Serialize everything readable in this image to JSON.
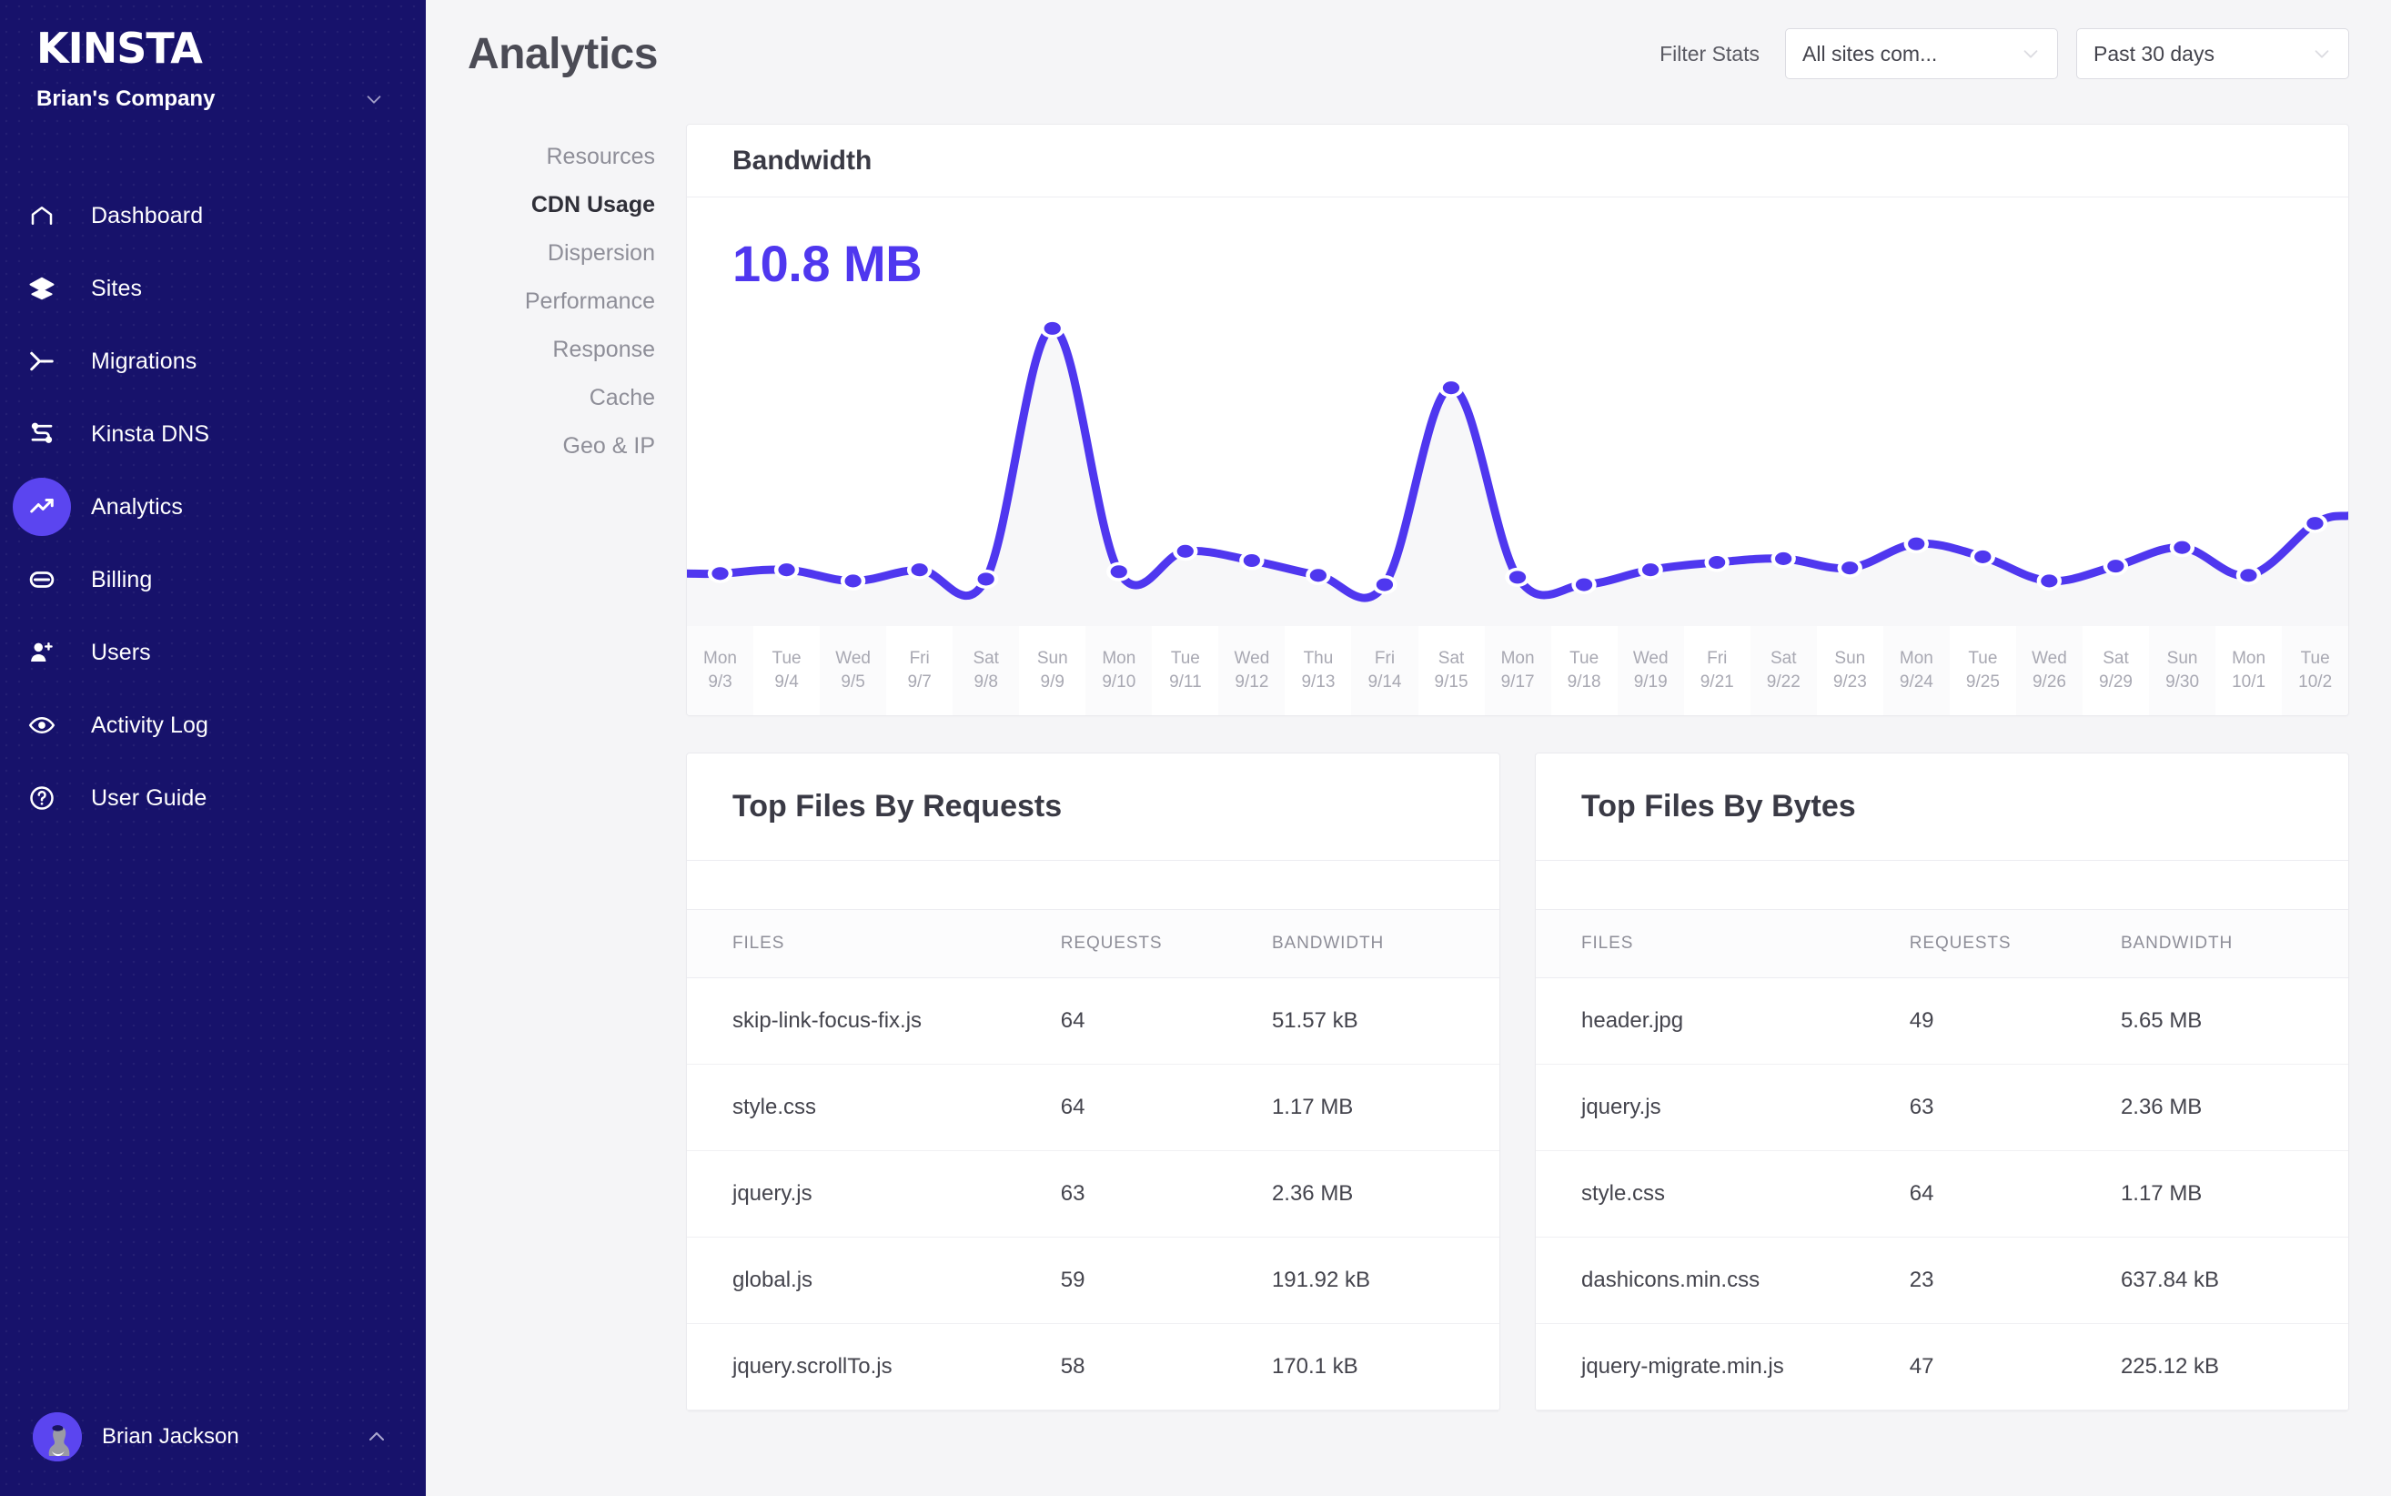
{
  "sidebar": {
    "logo": "KINSTA",
    "company": "Brian's Company",
    "company_chevron_icon": "chevron-down-icon",
    "items": [
      {
        "label": "Dashboard",
        "icon": "home-icon",
        "active": false
      },
      {
        "label": "Sites",
        "icon": "layers-icon",
        "active": false
      },
      {
        "label": "Migrations",
        "icon": "migrations-icon",
        "active": false
      },
      {
        "label": "Kinsta DNS",
        "icon": "dns-icon",
        "active": false
      },
      {
        "label": "Analytics",
        "icon": "trend-up-icon",
        "active": true
      },
      {
        "label": "Billing",
        "icon": "card-icon",
        "active": false
      },
      {
        "label": "Users",
        "icon": "user-plus-icon",
        "active": false
      },
      {
        "label": "Activity Log",
        "icon": "eye-icon",
        "active": false
      },
      {
        "label": "User Guide",
        "icon": "question-circle-icon",
        "active": false
      }
    ],
    "user": {
      "name": "Brian Jackson",
      "caret_icon": "chevron-up-icon"
    }
  },
  "header": {
    "title": "Analytics",
    "filter_label": "Filter Stats",
    "site_select": {
      "value": "All sites com...",
      "chevron_icon": "chevron-down-icon"
    },
    "range_select": {
      "value": "Past 30 days",
      "chevron_icon": "chevron-down-icon"
    }
  },
  "subnav": {
    "items": [
      {
        "label": "Resources",
        "active": false
      },
      {
        "label": "CDN Usage",
        "active": true
      },
      {
        "label": "Dispersion",
        "active": false
      },
      {
        "label": "Performance",
        "active": false
      },
      {
        "label": "Response",
        "active": false
      },
      {
        "label": "Cache",
        "active": false
      },
      {
        "label": "Geo & IP",
        "active": false
      }
    ]
  },
  "bandwidth_card": {
    "title": "Bandwidth",
    "value": "10.8 MB"
  },
  "chart_data": {
    "type": "line",
    "title": "Bandwidth",
    "xlabel": "",
    "ylabel": "Bandwidth",
    "grid": false,
    "legend": "none",
    "series_color": "#4f37ef",
    "fill_color": "#f7f7f9",
    "total_label": "10.8 MB",
    "units": "MB",
    "ylim": [
      0,
      1.6
    ],
    "categories": [
      "Mon 9/3",
      "Tue 9/4",
      "Wed 9/5",
      "Fri 9/7",
      "Sat 9/8",
      "Sun 9/9",
      "Mon 9/10",
      "Tue 9/11",
      "Wed 9/12",
      "Thu 9/13",
      "Fri 9/14",
      "Sat 9/15",
      "Mon 9/17",
      "Tue 9/18",
      "Wed 9/19",
      "Fri 9/21",
      "Sat 9/22",
      "Sun 9/23",
      "Mon 9/24",
      "Tue 9/25",
      "Wed 9/26",
      "Sat 9/29",
      "Sun 9/30",
      "Mon 10/1",
      "Tue 10/2"
    ],
    "tick_days": [
      "Mon",
      "Tue",
      "Wed",
      "Fri",
      "Sat",
      "Sun",
      "Mon",
      "Tue",
      "Wed",
      "Thu",
      "Fri",
      "Sat",
      "Mon",
      "Tue",
      "Wed",
      "Fri",
      "Sat",
      "Sun",
      "Mon",
      "Tue",
      "Wed",
      "Sat",
      "Sun",
      "Mon",
      "Tue"
    ],
    "tick_dates": [
      "9/3",
      "9/4",
      "9/5",
      "9/7",
      "9/8",
      "9/9",
      "9/10",
      "9/11",
      "9/12",
      "9/13",
      "9/14",
      "9/15",
      "9/17",
      "9/18",
      "9/19",
      "9/21",
      "9/22",
      "9/23",
      "9/24",
      "9/25",
      "9/26",
      "9/29",
      "9/30",
      "10/1",
      "10/2"
    ],
    "values": [
      0.2,
      0.22,
      0.16,
      0.22,
      0.17,
      1.52,
      0.21,
      0.32,
      0.27,
      0.19,
      0.14,
      1.2,
      0.18,
      0.14,
      0.22,
      0.26,
      0.28,
      0.23,
      0.36,
      0.29,
      0.16,
      0.24,
      0.34,
      0.19,
      0.47
    ]
  },
  "table_requests": {
    "title": "Top Files By Requests",
    "columns": [
      "FILES",
      "REQUESTS",
      "BANDWIDTH"
    ],
    "rows": [
      {
        "file": "skip-link-focus-fix.js",
        "requests": "64",
        "bandwidth": "51.57 kB"
      },
      {
        "file": "style.css",
        "requests": "64",
        "bandwidth": "1.17 MB"
      },
      {
        "file": "jquery.js",
        "requests": "63",
        "bandwidth": "2.36 MB"
      },
      {
        "file": "global.js",
        "requests": "59",
        "bandwidth": "191.92 kB"
      },
      {
        "file": "jquery.scrollTo.js",
        "requests": "58",
        "bandwidth": "170.1 kB"
      }
    ]
  },
  "table_bytes": {
    "title": "Top Files By Bytes",
    "columns": [
      "FILES",
      "REQUESTS",
      "BANDWIDTH"
    ],
    "rows": [
      {
        "file": "header.jpg",
        "requests": "49",
        "bandwidth": "5.65 MB"
      },
      {
        "file": "jquery.js",
        "requests": "63",
        "bandwidth": "2.36 MB"
      },
      {
        "file": "style.css",
        "requests": "64",
        "bandwidth": "1.17 MB"
      },
      {
        "file": "dashicons.min.css",
        "requests": "23",
        "bandwidth": "637.84 kB"
      },
      {
        "file": "jquery-migrate.min.js",
        "requests": "47",
        "bandwidth": "225.12 kB"
      }
    ]
  },
  "colors": {
    "sidebar_bg": "#17126b",
    "accent": "#4f37ef",
    "accent_soft": "#5b45f0",
    "page_bg": "#f5f5f7",
    "card_bg": "#ffffff",
    "text_primary": "#3a3a45",
    "text_muted": "#8e8e98"
  }
}
